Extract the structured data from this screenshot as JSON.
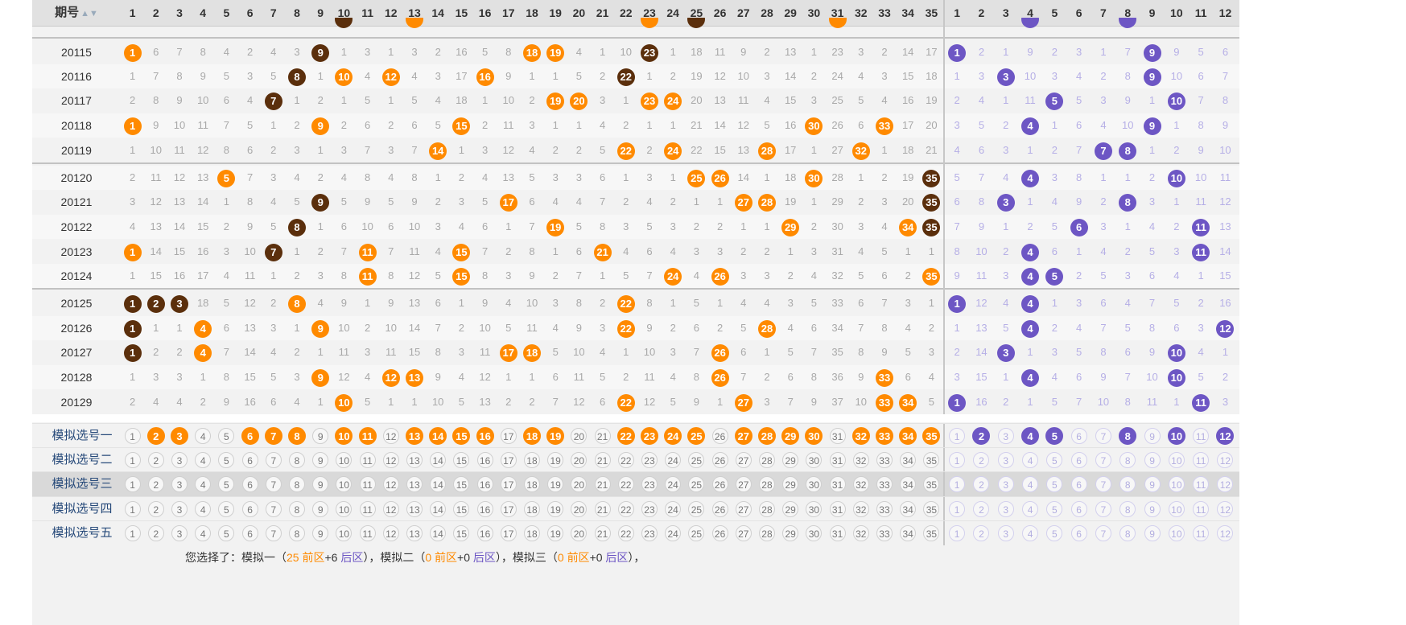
{
  "header": {
    "label": "期号",
    "sort_icon": "sort-icon",
    "front_numbers": [
      "1",
      "2",
      "3",
      "4",
      "5",
      "6",
      "7",
      "8",
      "9",
      "10",
      "11",
      "12",
      "13",
      "14",
      "15",
      "16",
      "17",
      "18",
      "19",
      "20",
      "21",
      "22",
      "23",
      "24",
      "25",
      "26",
      "27",
      "28",
      "29",
      "30",
      "31",
      "32",
      "33",
      "34",
      "35"
    ],
    "back_numbers": [
      "1",
      "2",
      "3",
      "4",
      "5",
      "6",
      "7",
      "8",
      "9",
      "10",
      "11",
      "12"
    ]
  },
  "colors": {
    "front_hit": "#ff8a00",
    "front_consecutive": "#5b2f0c",
    "back_hit": "#6d56c4",
    "header_bg": "#e1e1e1"
  },
  "partial_top": {
    "hits": [
      {
        "col": 9,
        "text": "",
        "kind": "d"
      },
      {
        "col": 12,
        "text": "",
        "kind": "o"
      },
      {
        "col": 22,
        "text": "",
        "kind": "o"
      },
      {
        "col": 24,
        "text": "",
        "kind": "d"
      },
      {
        "col": 30,
        "text": "",
        "kind": "o"
      },
      {
        "col": 38,
        "text": "",
        "kind": "p"
      },
      {
        "col": 42,
        "text": "",
        "kind": "p"
      }
    ]
  },
  "rows": [
    {
      "issue": "20115",
      "front": [
        "1",
        "6",
        "7",
        "8",
        "4",
        "2",
        "4",
        "3",
        "9",
        "1",
        "3",
        "1",
        "3",
        "2",
        "16",
        "5",
        "8",
        "18",
        "19",
        "4",
        "1",
        "10",
        "23",
        "1",
        "18",
        "11",
        "9",
        "2",
        "13",
        "1",
        "23",
        "3",
        "2",
        "14",
        "17"
      ],
      "front_hits": {
        "1": "o",
        "9": "d",
        "18": "o",
        "19": "o",
        "23": "d"
      },
      "back": [
        "1",
        "2",
        "1",
        "9",
        "2",
        "3",
        "1",
        "7",
        "9",
        "9",
        "5",
        "6"
      ],
      "back_hits": [
        1,
        9
      ]
    },
    {
      "issue": "20116",
      "front": [
        "1",
        "7",
        "8",
        "9",
        "5",
        "3",
        "5",
        "8",
        "1",
        "10",
        "4",
        "12",
        "4",
        "3",
        "17",
        "16",
        "9",
        "1",
        "1",
        "5",
        "2",
        "22",
        "1",
        "2",
        "19",
        "12",
        "10",
        "3",
        "14",
        "2",
        "24",
        "4",
        "3",
        "15",
        "18"
      ],
      "front_hits": {
        "8": "d",
        "10": "o",
        "12": "o",
        "16": "o",
        "22": "d"
      },
      "back": [
        "1",
        "3",
        "3",
        "10",
        "3",
        "4",
        "2",
        "8",
        "9",
        "10",
        "6",
        "7"
      ],
      "back_hits": [
        3,
        9
      ]
    },
    {
      "issue": "20117",
      "front": [
        "2",
        "8",
        "9",
        "10",
        "6",
        "4",
        "7",
        "1",
        "2",
        "1",
        "5",
        "1",
        "5",
        "4",
        "18",
        "1",
        "10",
        "2",
        "19",
        "20",
        "3",
        "1",
        "23",
        "24",
        "20",
        "13",
        "11",
        "4",
        "15",
        "3",
        "25",
        "5",
        "4",
        "16",
        "19"
      ],
      "front_hits": {
        "7": "d",
        "19": "o",
        "20": "o",
        "23": "o",
        "24": "o"
      },
      "back": [
        "2",
        "4",
        "1",
        "11",
        "5",
        "5",
        "3",
        "9",
        "1",
        "10",
        "7",
        "8"
      ],
      "back_hits": [
        5,
        10
      ]
    },
    {
      "issue": "20118",
      "front": [
        "1",
        "9",
        "10",
        "11",
        "7",
        "5",
        "1",
        "2",
        "9",
        "2",
        "6",
        "2",
        "6",
        "5",
        "15",
        "2",
        "11",
        "3",
        "1",
        "1",
        "4",
        "2",
        "1",
        "1",
        "21",
        "14",
        "12",
        "5",
        "16",
        "30",
        "26",
        "6",
        "33",
        "17",
        "20"
      ],
      "front_hits": {
        "1": "o",
        "9": "o",
        "15": "o",
        "30": "o",
        "33": "o"
      },
      "back": [
        "3",
        "5",
        "2",
        "4",
        "1",
        "6",
        "4",
        "10",
        "9",
        "1",
        "8",
        "9"
      ],
      "back_hits": [
        4,
        9
      ]
    },
    {
      "issue": "20119",
      "front": [
        "1",
        "10",
        "11",
        "12",
        "8",
        "6",
        "2",
        "3",
        "1",
        "3",
        "7",
        "3",
        "7",
        "14",
        "1",
        "3",
        "12",
        "4",
        "2",
        "2",
        "5",
        "22",
        "2",
        "24",
        "22",
        "15",
        "13",
        "28",
        "17",
        "1",
        "27",
        "32",
        "1",
        "18",
        "21"
      ],
      "front_hits": {
        "14": "o",
        "22": "o",
        "24": "o",
        "28": "o",
        "32": "o"
      },
      "back": [
        "4",
        "6",
        "3",
        "1",
        "2",
        "7",
        "7",
        "8",
        "1",
        "2",
        "9",
        "10"
      ],
      "back_hits": [
        7,
        8
      ]
    },
    {
      "issue": "20120",
      "front": [
        "2",
        "11",
        "12",
        "13",
        "5",
        "7",
        "3",
        "4",
        "2",
        "4",
        "8",
        "4",
        "8",
        "1",
        "2",
        "4",
        "13",
        "5",
        "3",
        "3",
        "6",
        "1",
        "3",
        "1",
        "25",
        "26",
        "14",
        "1",
        "18",
        "30",
        "28",
        "1",
        "2",
        "19",
        "35"
      ],
      "front_hits": {
        "5": "o",
        "25": "o",
        "26": "o",
        "30": "o",
        "35": "d"
      },
      "back": [
        "5",
        "7",
        "4",
        "4",
        "3",
        "8",
        "1",
        "1",
        "2",
        "10",
        "10",
        "11"
      ],
      "back_hits": [
        4,
        10
      ]
    },
    {
      "issue": "20121",
      "front": [
        "3",
        "12",
        "13",
        "14",
        "1",
        "8",
        "4",
        "5",
        "9",
        "5",
        "9",
        "5",
        "9",
        "2",
        "3",
        "5",
        "17",
        "6",
        "4",
        "4",
        "7",
        "2",
        "4",
        "2",
        "1",
        "1",
        "27",
        "28",
        "19",
        "1",
        "29",
        "2",
        "3",
        "20",
        "35"
      ],
      "front_hits": {
        "9": "d",
        "17": "o",
        "27": "o",
        "28": "o",
        "35": "d"
      },
      "back": [
        "6",
        "8",
        "3",
        "1",
        "4",
        "9",
        "2",
        "8",
        "3",
        "1",
        "11",
        "12"
      ],
      "back_hits": [
        3,
        8
      ]
    },
    {
      "issue": "20122",
      "front": [
        "4",
        "13",
        "14",
        "15",
        "2",
        "9",
        "5",
        "8",
        "1",
        "6",
        "10",
        "6",
        "10",
        "3",
        "4",
        "6",
        "1",
        "7",
        "19",
        "5",
        "8",
        "3",
        "5",
        "3",
        "2",
        "2",
        "1",
        "1",
        "29",
        "2",
        "30",
        "3",
        "4",
        "34",
        "35"
      ],
      "front_hits": {
        "8": "d",
        "19": "o",
        "29": "o",
        "34": "o",
        "35": "d"
      },
      "back": [
        "7",
        "9",
        "1",
        "2",
        "5",
        "6",
        "3",
        "1",
        "4",
        "2",
        "11",
        "13"
      ],
      "back_hits": [
        6,
        11
      ]
    },
    {
      "issue": "20123",
      "front": [
        "1",
        "14",
        "15",
        "16",
        "3",
        "10",
        "7",
        "1",
        "2",
        "7",
        "11",
        "7",
        "11",
        "4",
        "15",
        "7",
        "2",
        "8",
        "1",
        "6",
        "21",
        "4",
        "6",
        "4",
        "3",
        "3",
        "2",
        "2",
        "1",
        "3",
        "31",
        "4",
        "5",
        "1",
        "1"
      ],
      "front_hits": {
        "1": "o",
        "7": "d",
        "11": "o",
        "15": "o",
        "21": "o"
      },
      "back": [
        "8",
        "10",
        "2",
        "4",
        "6",
        "1",
        "4",
        "2",
        "5",
        "3",
        "11",
        "14"
      ],
      "back_hits": [
        4,
        11
      ]
    },
    {
      "issue": "20124",
      "front": [
        "1",
        "15",
        "16",
        "17",
        "4",
        "11",
        "1",
        "2",
        "3",
        "8",
        "11",
        "8",
        "12",
        "5",
        "15",
        "8",
        "3",
        "9",
        "2",
        "7",
        "1",
        "5",
        "7",
        "24",
        "4",
        "26",
        "3",
        "3",
        "2",
        "4",
        "32",
        "5",
        "6",
        "2",
        "35"
      ],
      "front_hits": {
        "11": "o",
        "15": "o",
        "24": "o",
        "26": "o",
        "35": "o"
      },
      "back": [
        "9",
        "11",
        "3",
        "4",
        "5",
        "2",
        "5",
        "3",
        "6",
        "4",
        "1",
        "15"
      ],
      "back_hits": [
        4,
        5
      ]
    },
    {
      "issue": "20125",
      "front": [
        "1",
        "2",
        "3",
        "18",
        "5",
        "12",
        "2",
        "8",
        "4",
        "9",
        "1",
        "9",
        "13",
        "6",
        "1",
        "9",
        "4",
        "10",
        "3",
        "8",
        "2",
        "22",
        "8",
        "1",
        "5",
        "1",
        "4",
        "4",
        "3",
        "5",
        "33",
        "6",
        "7",
        "3",
        "1"
      ],
      "front_hits": {
        "1": "d",
        "2": "d",
        "3": "d",
        "8": "o",
        "22": "o"
      },
      "back": [
        "1",
        "12",
        "4",
        "4",
        "1",
        "3",
        "6",
        "4",
        "7",
        "5",
        "2",
        "16"
      ],
      "back_hits": [
        1,
        4
      ]
    },
    {
      "issue": "20126",
      "front": [
        "1",
        "1",
        "1",
        "4",
        "6",
        "13",
        "3",
        "1",
        "9",
        "10",
        "2",
        "10",
        "14",
        "7",
        "2",
        "10",
        "5",
        "11",
        "4",
        "9",
        "3",
        "22",
        "9",
        "2",
        "6",
        "2",
        "5",
        "28",
        "4",
        "6",
        "34",
        "7",
        "8",
        "4",
        "2"
      ],
      "front_hits": {
        "1": "d",
        "4": "o",
        "9": "o",
        "22": "o",
        "28": "o"
      },
      "back": [
        "1",
        "13",
        "5",
        "4",
        "2",
        "4",
        "7",
        "5",
        "8",
        "6",
        "3",
        "12"
      ],
      "back_hits": [
        4,
        12
      ]
    },
    {
      "issue": "20127",
      "front": [
        "1",
        "2",
        "2",
        "4",
        "7",
        "14",
        "4",
        "2",
        "1",
        "11",
        "3",
        "11",
        "15",
        "8",
        "3",
        "11",
        "17",
        "18",
        "5",
        "10",
        "4",
        "1",
        "10",
        "3",
        "7",
        "26",
        "6",
        "1",
        "5",
        "7",
        "35",
        "8",
        "9",
        "5",
        "3"
      ],
      "front_hits": {
        "1": "d",
        "4": "o",
        "17": "o",
        "18": "o",
        "26": "o"
      },
      "back": [
        "2",
        "14",
        "3",
        "1",
        "3",
        "5",
        "8",
        "6",
        "9",
        "10",
        "4",
        "1"
      ],
      "back_hits": [
        3,
        10
      ]
    },
    {
      "issue": "20128",
      "front": [
        "1",
        "3",
        "3",
        "1",
        "8",
        "15",
        "5",
        "3",
        "9",
        "12",
        "4",
        "12",
        "13",
        "9",
        "4",
        "12",
        "1",
        "1",
        "6",
        "11",
        "5",
        "2",
        "11",
        "4",
        "8",
        "26",
        "7",
        "2",
        "6",
        "8",
        "36",
        "9",
        "33",
        "6",
        "4"
      ],
      "front_hits": {
        "9": "o",
        "12": "o",
        "13": "o",
        "26": "o",
        "33": "o"
      },
      "back": [
        "3",
        "15",
        "1",
        "4",
        "4",
        "6",
        "9",
        "7",
        "10",
        "10",
        "5",
        "2"
      ],
      "back_hits": [
        4,
        10
      ]
    },
    {
      "issue": "20129",
      "front": [
        "2",
        "4",
        "4",
        "2",
        "9",
        "16",
        "6",
        "4",
        "1",
        "10",
        "5",
        "1",
        "1",
        "10",
        "5",
        "13",
        "2",
        "2",
        "7",
        "12",
        "6",
        "22",
        "12",
        "5",
        "9",
        "1",
        "27",
        "3",
        "7",
        "9",
        "37",
        "10",
        "33",
        "34",
        "5"
      ],
      "front_hits": {
        "10": "o",
        "22": "o",
        "27": "o",
        "33": "o",
        "34": "o"
      },
      "back": [
        "1",
        "16",
        "2",
        "1",
        "5",
        "7",
        "10",
        "8",
        "11",
        "1",
        "11",
        "3"
      ],
      "back_hits": [
        1,
        11
      ]
    }
  ],
  "simulations": [
    {
      "label": "模拟选号一",
      "front_selected": [
        2,
        3,
        6,
        7,
        8,
        10,
        11,
        13,
        14,
        15,
        16,
        18,
        19,
        22,
        23,
        24,
        25,
        27,
        28,
        29,
        30,
        32,
        33,
        34,
        35
      ],
      "back_selected": [
        2,
        4,
        5,
        8,
        10,
        12
      ],
      "highlight": false
    },
    {
      "label": "模拟选号二",
      "front_selected": [],
      "back_selected": [],
      "highlight": false
    },
    {
      "label": "模拟选号三",
      "front_selected": [],
      "back_selected": [],
      "highlight": true
    },
    {
      "label": "模拟选号四",
      "front_selected": [],
      "back_selected": [],
      "highlight": false
    },
    {
      "label": "模拟选号五",
      "front_selected": [],
      "back_selected": [],
      "highlight": false
    }
  ],
  "summary": {
    "prefix": "您选择了：",
    "items": [
      {
        "name": "模拟一",
        "front_count": "25",
        "front_word": "前区",
        "back_count": "+6",
        "back_word": "后区"
      },
      {
        "name": "模拟二",
        "front_count": "0",
        "front_word": "前区",
        "back_count": "+0",
        "back_word": "后区"
      },
      {
        "name": "模拟三",
        "front_count": "0",
        "front_word": "前区",
        "back_count": "+0",
        "back_word": "后区"
      }
    ]
  }
}
